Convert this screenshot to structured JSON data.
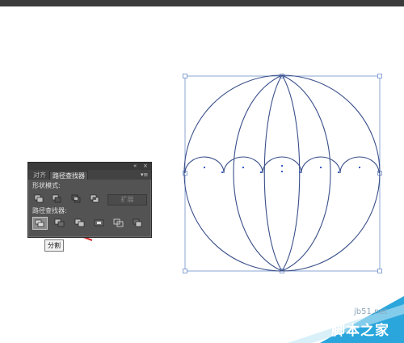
{
  "panel": {
    "tabs": [
      {
        "label": "对齐"
      },
      {
        "label": "路径查找器"
      }
    ],
    "collapse_icon": "«",
    "close_icon": "×",
    "menu_icon": "▾≡",
    "shape_modes_label": "形状模式:",
    "pathfinders_label": "路径查找器:",
    "expand_label": "扩展",
    "shape_mode_icons": [
      "unite-icon",
      "minus-front-icon",
      "intersect-icon",
      "exclude-icon"
    ],
    "pathfinder_icons": [
      "divide-icon",
      "trim-icon",
      "merge-icon",
      "crop-icon",
      "outline-icon",
      "minus-back-icon"
    ]
  },
  "tooltip": {
    "text": "分割"
  },
  "watermark": {
    "url": "jb51.net",
    "name": "脚本之家"
  },
  "colors": {
    "art_stroke": "#3a4f8a",
    "selection": "#6f8fc9",
    "arrow": "#d42b2b",
    "panel_bg": "#535353"
  }
}
